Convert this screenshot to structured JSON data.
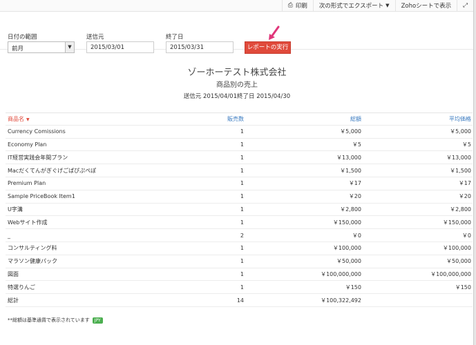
{
  "toolbar": {
    "print_label": "印刷",
    "export_label": "次の形式でエクスポート",
    "sheet_label": "Zohoシートで表示"
  },
  "filters": {
    "date_range_label": "日付の範囲",
    "date_range_value": "前月",
    "from_label": "送信元",
    "from_value": "2015/03/01",
    "to_label": "終了日",
    "to_value": "2015/03/31",
    "run_label": "レポートの実行"
  },
  "report": {
    "company": "ゾーホーテスト株式会社",
    "title": "商品別の売上",
    "period": "送信元 2015/04/01終了日 2015/04/30"
  },
  "table": {
    "headers": [
      "商品名",
      "販売数",
      "総額",
      "平均価格"
    ],
    "rows": [
      [
        "Currency Comissions",
        "1",
        "￥5,000",
        "￥5,000"
      ],
      [
        "Economy Plan",
        "1",
        "￥5",
        "￥5"
      ],
      [
        "IT経営実践会年間プラン",
        "1",
        "￥13,000",
        "￥13,000"
      ],
      [
        "Macだくてんがぎぐげごぱぴぷぺぽ",
        "1",
        "￥1,500",
        "￥1,500"
      ],
      [
        "Premium Plan",
        "1",
        "￥17",
        "￥17"
      ],
      [
        "Sample PriceBook Item1",
        "1",
        "￥20",
        "￥20"
      ],
      [
        "U字溝",
        "1",
        "￥2,800",
        "￥2,800"
      ],
      [
        "Webサイト作成",
        "1",
        "￥150,000",
        "￥150,000"
      ],
      [
        "_",
        "2",
        "￥0",
        "￥0"
      ],
      [
        "コンサルティング料",
        "1",
        "￥100,000",
        "￥100,000"
      ],
      [
        "マラソン健康パック",
        "1",
        "￥50,000",
        "￥50,000"
      ],
      [
        "図面",
        "1",
        "￥100,000,000",
        "￥100,000,000"
      ],
      [
        "特選りんご",
        "1",
        "￥150",
        "￥150"
      ]
    ],
    "total": [
      "総計",
      "14",
      "￥100,322,492",
      ""
    ]
  },
  "footer": {
    "note": "**総額は基準通貨で表示されています",
    "currency_badge": "JPY"
  }
}
